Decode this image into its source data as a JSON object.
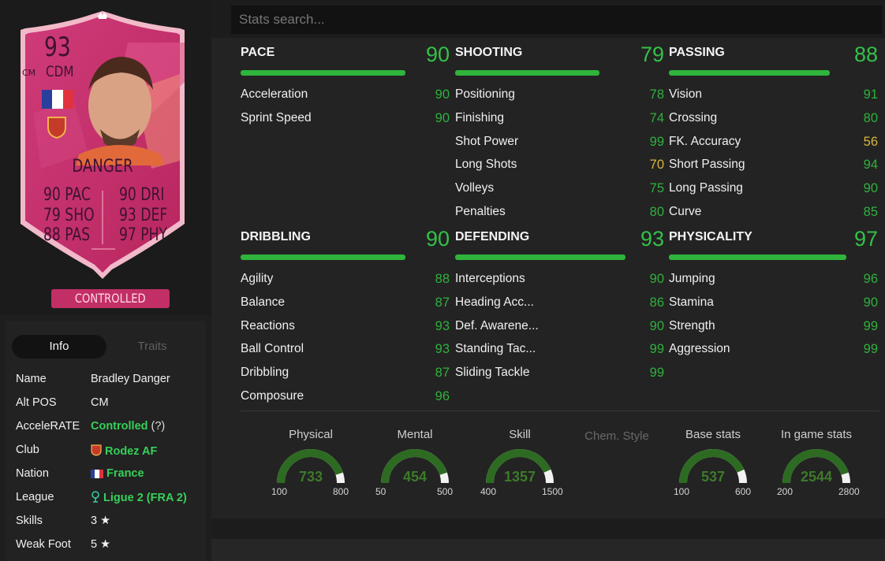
{
  "card": {
    "rating": "93",
    "position": "CDM",
    "alt_position": "CM",
    "name": "DANGER",
    "stats_left": [
      {
        "value": "90",
        "label": "PAC"
      },
      {
        "value": "79",
        "label": "SHO"
      },
      {
        "value": "88",
        "label": "PAS"
      }
    ],
    "stats_right": [
      {
        "value": "90",
        "label": "DRI"
      },
      {
        "value": "93",
        "label": "DEF"
      },
      {
        "value": "97",
        "label": "PHY"
      }
    ],
    "badge": "CONTROLLED",
    "colors": {
      "card_main": "#c7346f",
      "card_border": "#e7a0b8",
      "badge": "#c22e66"
    }
  },
  "tabs": {
    "info": "Info",
    "traits": "Traits"
  },
  "info": {
    "name": {
      "label": "Name",
      "value": "Bradley Danger"
    },
    "alt_pos": {
      "label": "Alt POS",
      "value": "CM"
    },
    "accelerate": {
      "label": "AcceleRATE",
      "value": "Controlled",
      "hint": "(?)"
    },
    "club": {
      "label": "Club",
      "value": "Rodez AF"
    },
    "nation": {
      "label": "Nation",
      "value": "France"
    },
    "league": {
      "label": "League",
      "value": "Ligue 2 (FRA 2)"
    },
    "skills": {
      "label": "Skills",
      "value": "3"
    },
    "weak_foot": {
      "label": "Weak Foot",
      "value": "5"
    }
  },
  "search": {
    "placeholder": "Stats search..."
  },
  "categories": [
    {
      "title": "PACE",
      "value": "90",
      "fill": 0.9,
      "stats": [
        {
          "name": "Acceleration",
          "value": "90"
        },
        {
          "name": "Sprint Speed",
          "value": "90"
        }
      ]
    },
    {
      "title": "SHOOTING",
      "value": "79",
      "fill": 0.79,
      "stats": [
        {
          "name": "Positioning",
          "value": "78"
        },
        {
          "name": "Finishing",
          "value": "74"
        },
        {
          "name": "Shot Power",
          "value": "99"
        },
        {
          "name": "Long Shots",
          "value": "70"
        },
        {
          "name": "Volleys",
          "value": "75"
        },
        {
          "name": "Penalties",
          "value": "80"
        }
      ]
    },
    {
      "title": "PASSING",
      "value": "88",
      "fill": 0.88,
      "stats": [
        {
          "name": "Vision",
          "value": "91"
        },
        {
          "name": "Crossing",
          "value": "80"
        },
        {
          "name": "FK. Accuracy",
          "value": "56"
        },
        {
          "name": "Short Passing",
          "value": "94"
        },
        {
          "name": "Long Passing",
          "value": "90"
        },
        {
          "name": "Curve",
          "value": "85"
        }
      ]
    },
    {
      "title": "DRIBBLING",
      "value": "90",
      "fill": 0.9,
      "stats": [
        {
          "name": "Agility",
          "value": "88"
        },
        {
          "name": "Balance",
          "value": "87"
        },
        {
          "name": "Reactions",
          "value": "93"
        },
        {
          "name": "Ball Control",
          "value": "93"
        },
        {
          "name": "Dribbling",
          "value": "87"
        },
        {
          "name": "Composure",
          "value": "96"
        }
      ]
    },
    {
      "title": "DEFENDING",
      "value": "93",
      "fill": 0.93,
      "stats": [
        {
          "name": "Interceptions",
          "value": "90"
        },
        {
          "name": "Heading Acc...",
          "value": "86"
        },
        {
          "name": "Def. Awarene...",
          "value": "90"
        },
        {
          "name": "Standing Tac...",
          "value": "99"
        },
        {
          "name": "Sliding Tackle",
          "value": "99"
        }
      ]
    },
    {
      "title": "PHYSICALITY",
      "value": "97",
      "fill": 0.97,
      "stats": [
        {
          "name": "Jumping",
          "value": "96"
        },
        {
          "name": "Stamina",
          "value": "90"
        },
        {
          "name": "Strength",
          "value": "99"
        },
        {
          "name": "Aggression",
          "value": "99"
        }
      ]
    }
  ],
  "gauges": [
    {
      "label": "Physical",
      "value": "733",
      "min": "100",
      "max": "800",
      "fill": 0.9
    },
    {
      "label": "Mental",
      "value": "454",
      "min": "50",
      "max": "500",
      "fill": 0.9
    },
    {
      "label": "Skill",
      "value": "1357",
      "min": "400",
      "max": "1500",
      "fill": 0.87
    },
    {
      "label": "Base stats",
      "value": "537",
      "min": "100",
      "max": "600",
      "fill": 0.87
    },
    {
      "label": "In game stats",
      "value": "2544",
      "min": "200",
      "max": "2800",
      "fill": 0.9
    }
  ],
  "chem_style": {
    "label": "Chem. Style"
  }
}
